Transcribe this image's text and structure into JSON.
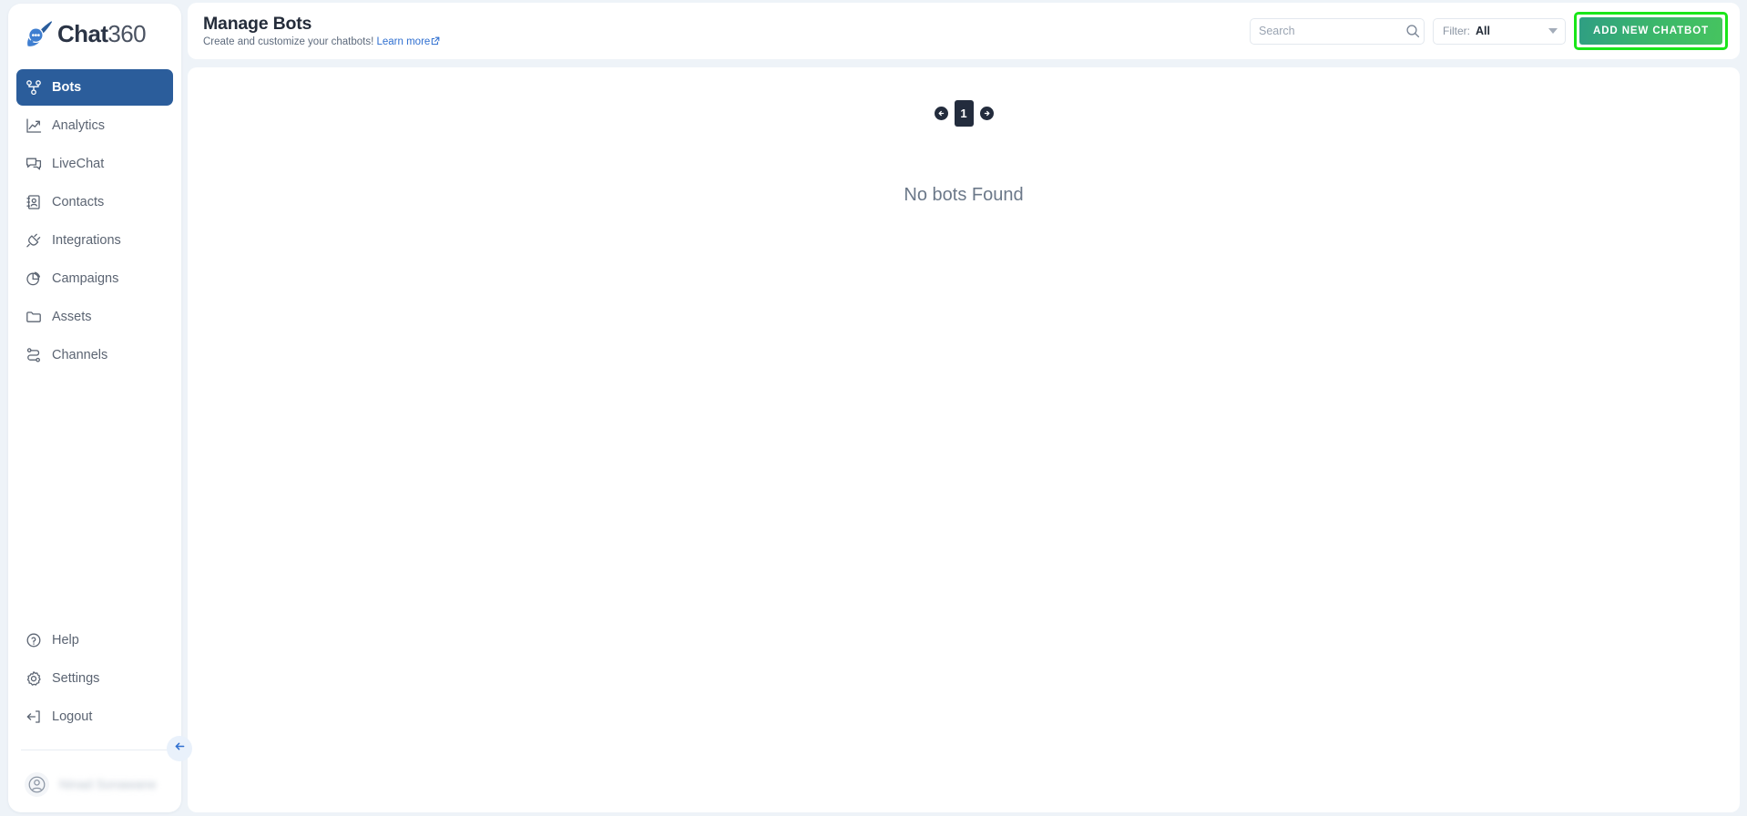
{
  "brand": {
    "logo_chat": "Chat",
    "logo_num": "360",
    "logo_icon": "chat-bubble-comet-icon",
    "accent_blue": "#2b5d9b",
    "accent_green": "#3cb86a",
    "highlight_green": "#19e619"
  },
  "sidebar": {
    "items": [
      {
        "label": "Bots",
        "icon": "bots-network-icon",
        "active": true
      },
      {
        "label": "Analytics",
        "icon": "analytics-chart-icon",
        "active": false
      },
      {
        "label": "LiveChat",
        "icon": "livechat-bubbles-icon",
        "active": false
      },
      {
        "label": "Contacts",
        "icon": "contacts-book-icon",
        "active": false
      },
      {
        "label": "Integrations",
        "icon": "plug-icon",
        "active": false
      },
      {
        "label": "Campaigns",
        "icon": "pie-chart-icon",
        "active": false
      },
      {
        "label": "Assets",
        "icon": "folder-icon",
        "active": false
      },
      {
        "label": "Channels",
        "icon": "channels-nodes-icon",
        "active": false
      }
    ],
    "bottom_items": [
      {
        "label": "Help",
        "icon": "question-circle-icon"
      },
      {
        "label": "Settings",
        "icon": "gear-icon"
      },
      {
        "label": "Logout",
        "icon": "logout-arrow-icon"
      }
    ],
    "profile": {
      "name": "Ninad Sonawane",
      "avatar_icon": "user-avatar-icon"
    },
    "collapse_icon": "arrow-left-icon"
  },
  "header": {
    "title": "Manage Bots",
    "subtitle_text": "Create and customize your chatbots!",
    "learn_more": "Learn more",
    "learn_more_icon": "external-link-icon",
    "search": {
      "value": "",
      "placeholder": "Search",
      "icon": "search-icon"
    },
    "filter": {
      "label": "Filter:",
      "value": "All",
      "icon": "chevron-down-icon"
    },
    "add_button": {
      "label": "ADD NEW CHATBOT"
    }
  },
  "main": {
    "pagination": {
      "prev_icon": "arrow-left-icon",
      "page": "1",
      "next_icon": "arrow-right-icon"
    },
    "empty_message": "No bots Found"
  }
}
